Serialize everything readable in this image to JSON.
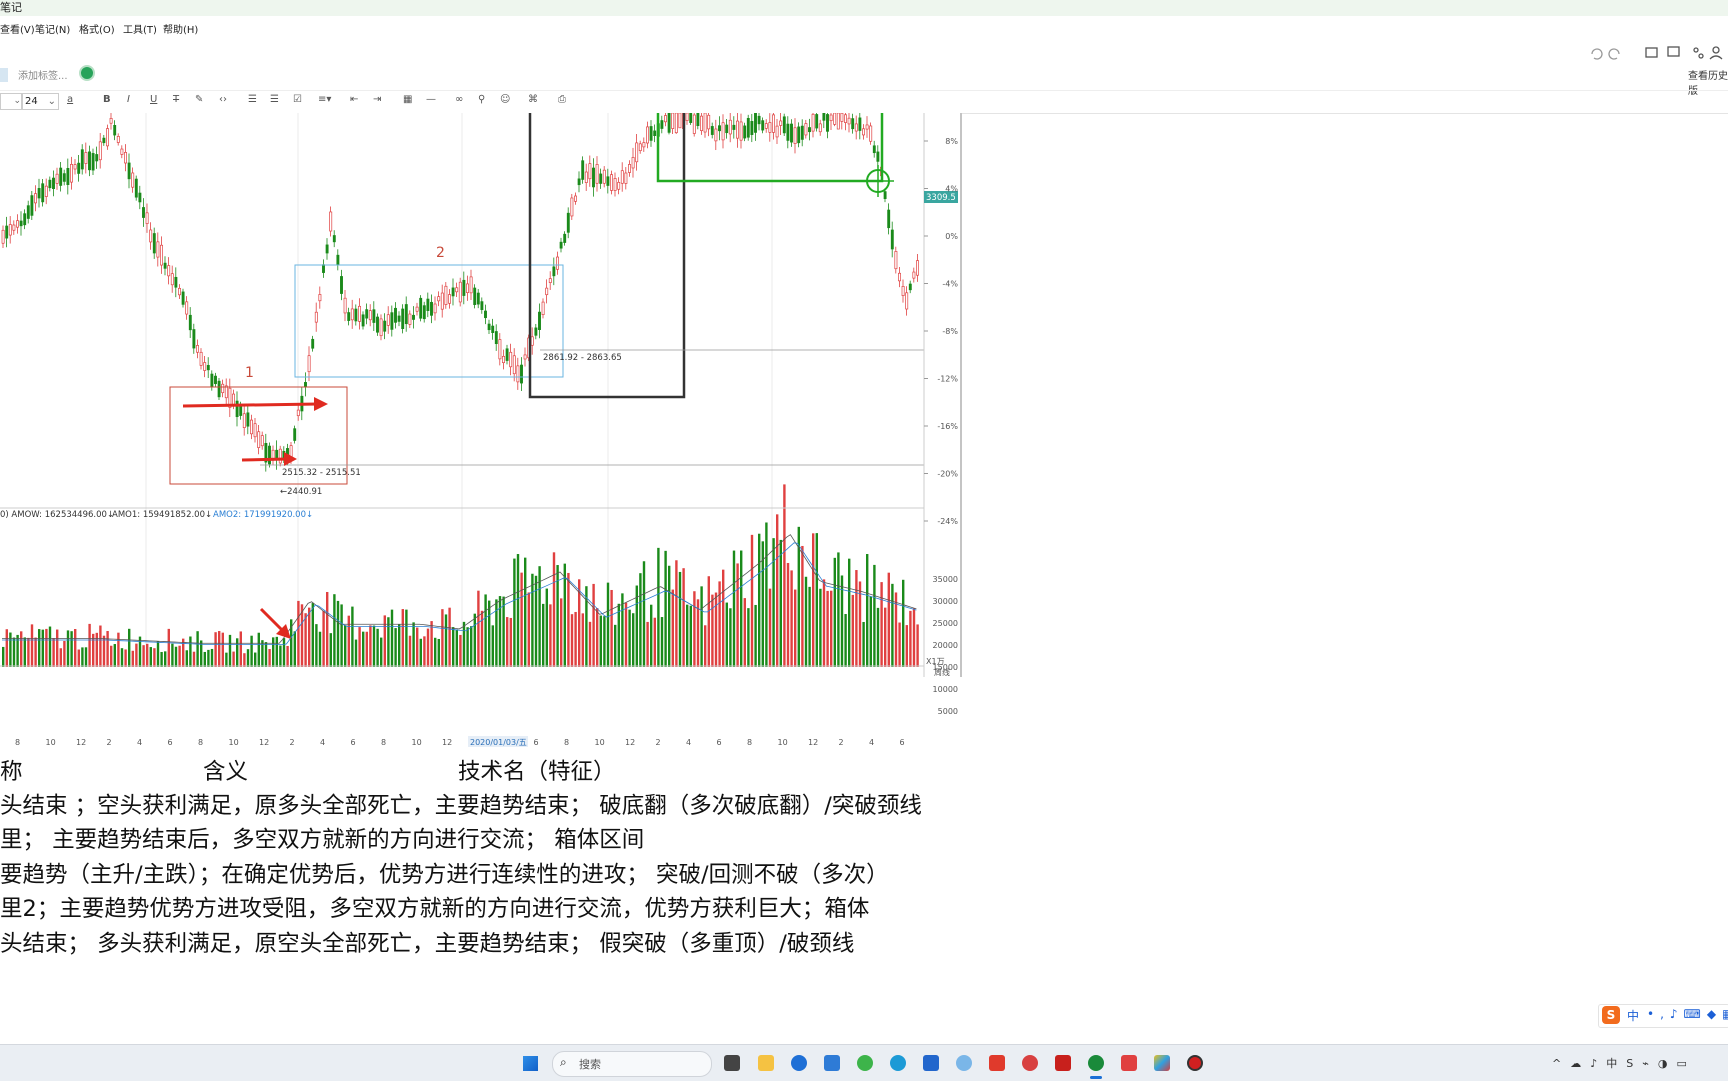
{
  "window": {
    "title": "笔记"
  },
  "menu": [
    "查看(V)",
    "笔记(N)",
    "格式(O)",
    "工具(T)",
    "帮助(H)"
  ],
  "header_right": {
    "history": "查看历史版"
  },
  "tags": {
    "placeholder": "添加标签..."
  },
  "toolbar": {
    "font_size": "24"
  },
  "chart": {
    "pct_ticks": [
      "8%",
      "4%",
      "0%",
      "-4%",
      "-8%",
      "-12%",
      "-16%",
      "-20%",
      "-24%"
    ],
    "price_tag": "3309.5",
    "box1_label": "1",
    "box2_label": "2",
    "range1": "2515.32 - 2515.51",
    "range2": "2861.92 - 2863.65",
    "low_label": "←2440.91",
    "vol_legend": [
      {
        "text": "0) AMOW: 162534496.00↓",
        "color": "#333333"
      },
      {
        "text": "AMO1: 159491852.00↓",
        "color": "#333333"
      },
      {
        "text": "AMO2: 171991920.00↓",
        "color": "#2a7fd4"
      }
    ],
    "vol_ticks": [
      "35000",
      "30000",
      "25000",
      "20000",
      "15000",
      "10000",
      "5000"
    ],
    "vol_unit": "X1万",
    "x_labels": [
      "8",
      "10",
      "12",
      "2",
      "4",
      "6",
      "8",
      "10",
      "12",
      "2",
      "4",
      "6",
      "8",
      "10",
      "12",
      "2",
      "4",
      "6",
      "8",
      "10",
      "12",
      "2",
      "4",
      "6",
      "8",
      "10",
      "12",
      "2",
      "4",
      "6"
    ],
    "date_label": "2020/01/03/五",
    "period_label": "周线",
    "colors": {
      "up": "#e04040",
      "down": "#1a8a1a",
      "box1": "#c84a3a",
      "box2": "#6ab4e0",
      "bracket_green": "#22aa22",
      "box_black": "#333333",
      "ma1": "#555555",
      "ma2": "#2a7fd4"
    }
  },
  "notes": {
    "header": [
      "称",
      "含义",
      "技术名（特征）"
    ],
    "lines": [
      "头结束 ；空头获利满足，原多头全部死亡，主要趋势结束； 破底翻（多次破底翻）/突破颈线",
      "里；   主要趋势结束后，多空双方就新的方向进行交流； 箱体区间",
      "要趋势（主升/主跌）；在确定优势后，优势方进行连续性的进攻； 突破/回测不破（多次）",
      "里2；主要趋势优势方进攻受阻，多空双方就新的方向进行交流，优势方获利巨大；箱体",
      "头结束； 多头获利满足，原空头全部死亡，主要趋势结束； 假突破（多重顶）/破颈线"
    ]
  },
  "taskbar": {
    "search_placeholder": "搜索",
    "ime_indicator": "中"
  }
}
